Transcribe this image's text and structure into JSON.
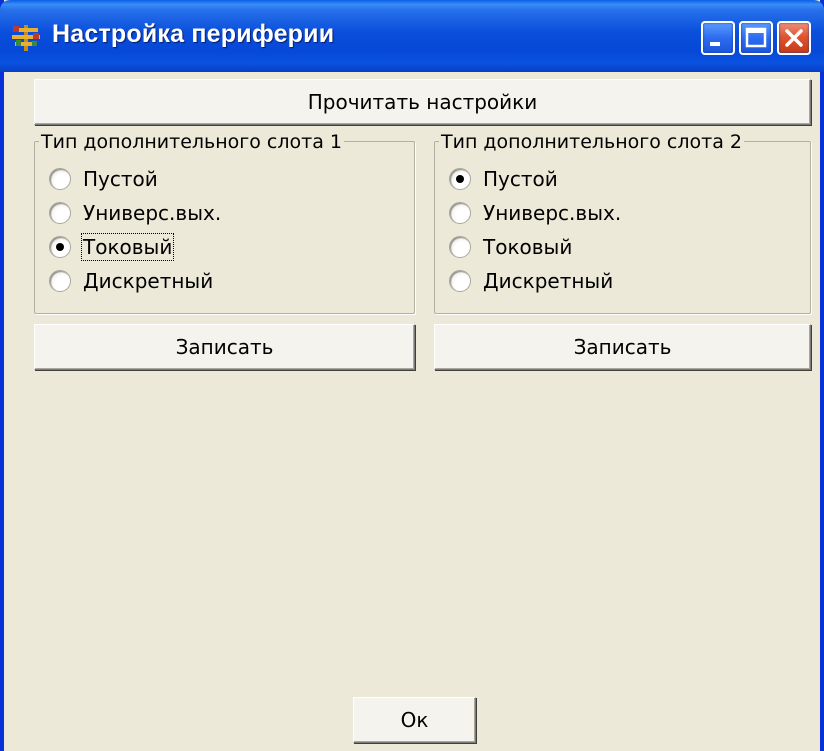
{
  "window": {
    "title": "Настройка периферии",
    "icon": "tree-app-icon",
    "controls": {
      "minimize": "minimize-icon",
      "maximize": "maximize-icon",
      "close": "close-icon"
    }
  },
  "buttons": {
    "read_settings": "Прочитать настройки",
    "write1": "Записать",
    "write2": "Записать",
    "ok": "Ок"
  },
  "slot1": {
    "legend": "Тип дополнительного слота 1",
    "options": [
      {
        "label": "Пустой",
        "checked": false
      },
      {
        "label": "Универс.вых.",
        "checked": false
      },
      {
        "label": "Токовый",
        "checked": true
      },
      {
        "label": "Дискретный",
        "checked": false
      }
    ]
  },
  "slot2": {
    "legend": "Тип дополнительного слота 2",
    "options": [
      {
        "label": "Пустой",
        "checked": true
      },
      {
        "label": "Универс.вых.",
        "checked": false
      },
      {
        "label": "Токовый",
        "checked": false
      },
      {
        "label": "Дискретный",
        "checked": false
      }
    ]
  },
  "colors": {
    "titlebar": "#0a4fdc",
    "window_bg": "#ece9d8",
    "close_button": "#e0542f"
  }
}
